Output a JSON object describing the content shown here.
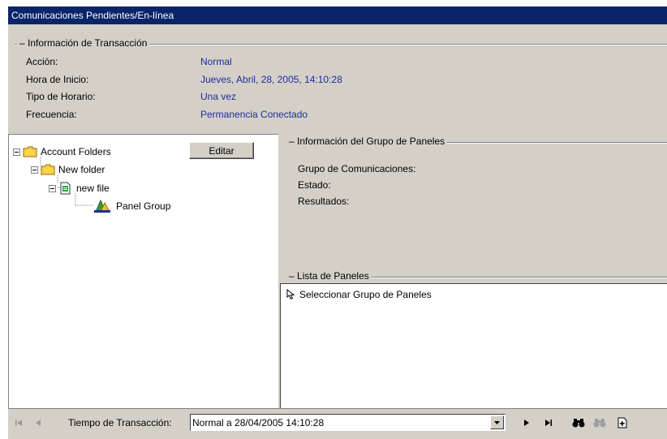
{
  "window": {
    "title": "Comunicaciones Pendientes/En-línea"
  },
  "transaction_info": {
    "group_title": "Información de Transacción",
    "fields": [
      {
        "label": "Acción:",
        "value": "Normal"
      },
      {
        "label": "Hora de Inicio:",
        "value": "Jueves, Abril, 28, 2005, 14:10:28"
      },
      {
        "label": "Tipo de Horario:",
        "value": "Una vez"
      },
      {
        "label": "Frecuencia:",
        "value": "Permanencia Conectado"
      }
    ]
  },
  "tree": {
    "edit_button": "Editar",
    "nodes": [
      {
        "label": "Account Folders",
        "icon": "folder-icon"
      },
      {
        "label": "New folder",
        "icon": "folder-icon"
      },
      {
        "label": "new file",
        "icon": "file-icon"
      },
      {
        "label": "Panel Group",
        "icon": "panel-group-icon"
      }
    ]
  },
  "panel_group_info": {
    "group_title": "Información del Grupo de Paneles",
    "fields": [
      {
        "label": "Grupo de Comunicaciones:"
      },
      {
        "label": "Estado:"
      },
      {
        "label": "Resultados:"
      }
    ]
  },
  "panel_list": {
    "group_title": "Lista de Paneles",
    "placeholder_item": "Seleccionar Grupo de Paneles"
  },
  "bottom_bar": {
    "label": "Tiempo de Transacción:",
    "selected_value": "Normal a 28/04/2005 14:10:28"
  }
}
